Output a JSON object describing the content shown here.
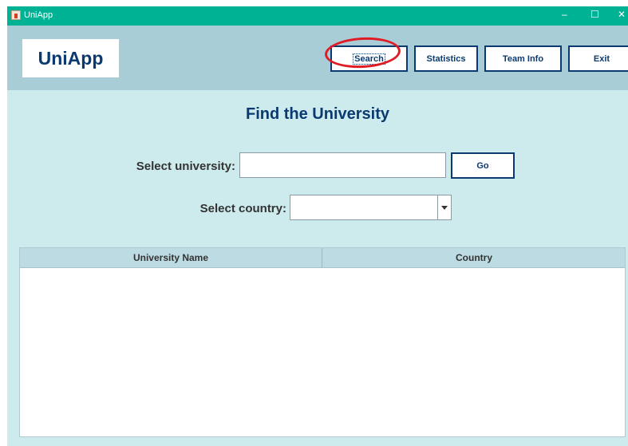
{
  "window": {
    "title": "UniApp",
    "controls": {
      "minimize": "–",
      "maximize": "☐",
      "close": "✕"
    }
  },
  "header": {
    "logo": "UniApp",
    "nav": {
      "search": "Search",
      "statistics": "Statistics",
      "team_info": "Team Info",
      "exit": "Exit"
    },
    "highlighted": "Search"
  },
  "main": {
    "title": "Find the University",
    "university_label": "Select university:",
    "university_value": "",
    "go_label": "Go",
    "country_label": "Select country:",
    "country_selected": ""
  },
  "table": {
    "columns": [
      "University Name",
      "Country"
    ],
    "rows": []
  },
  "colors": {
    "titlebar": "#00b294",
    "header_bg": "#a9cdd6",
    "content_bg": "#cdeaed",
    "brand_blue": "#0b3a70",
    "highlight_red": "#e01b24"
  },
  "icons": {
    "app": "java-app-icon",
    "dropdown": "chevron-down-icon"
  }
}
